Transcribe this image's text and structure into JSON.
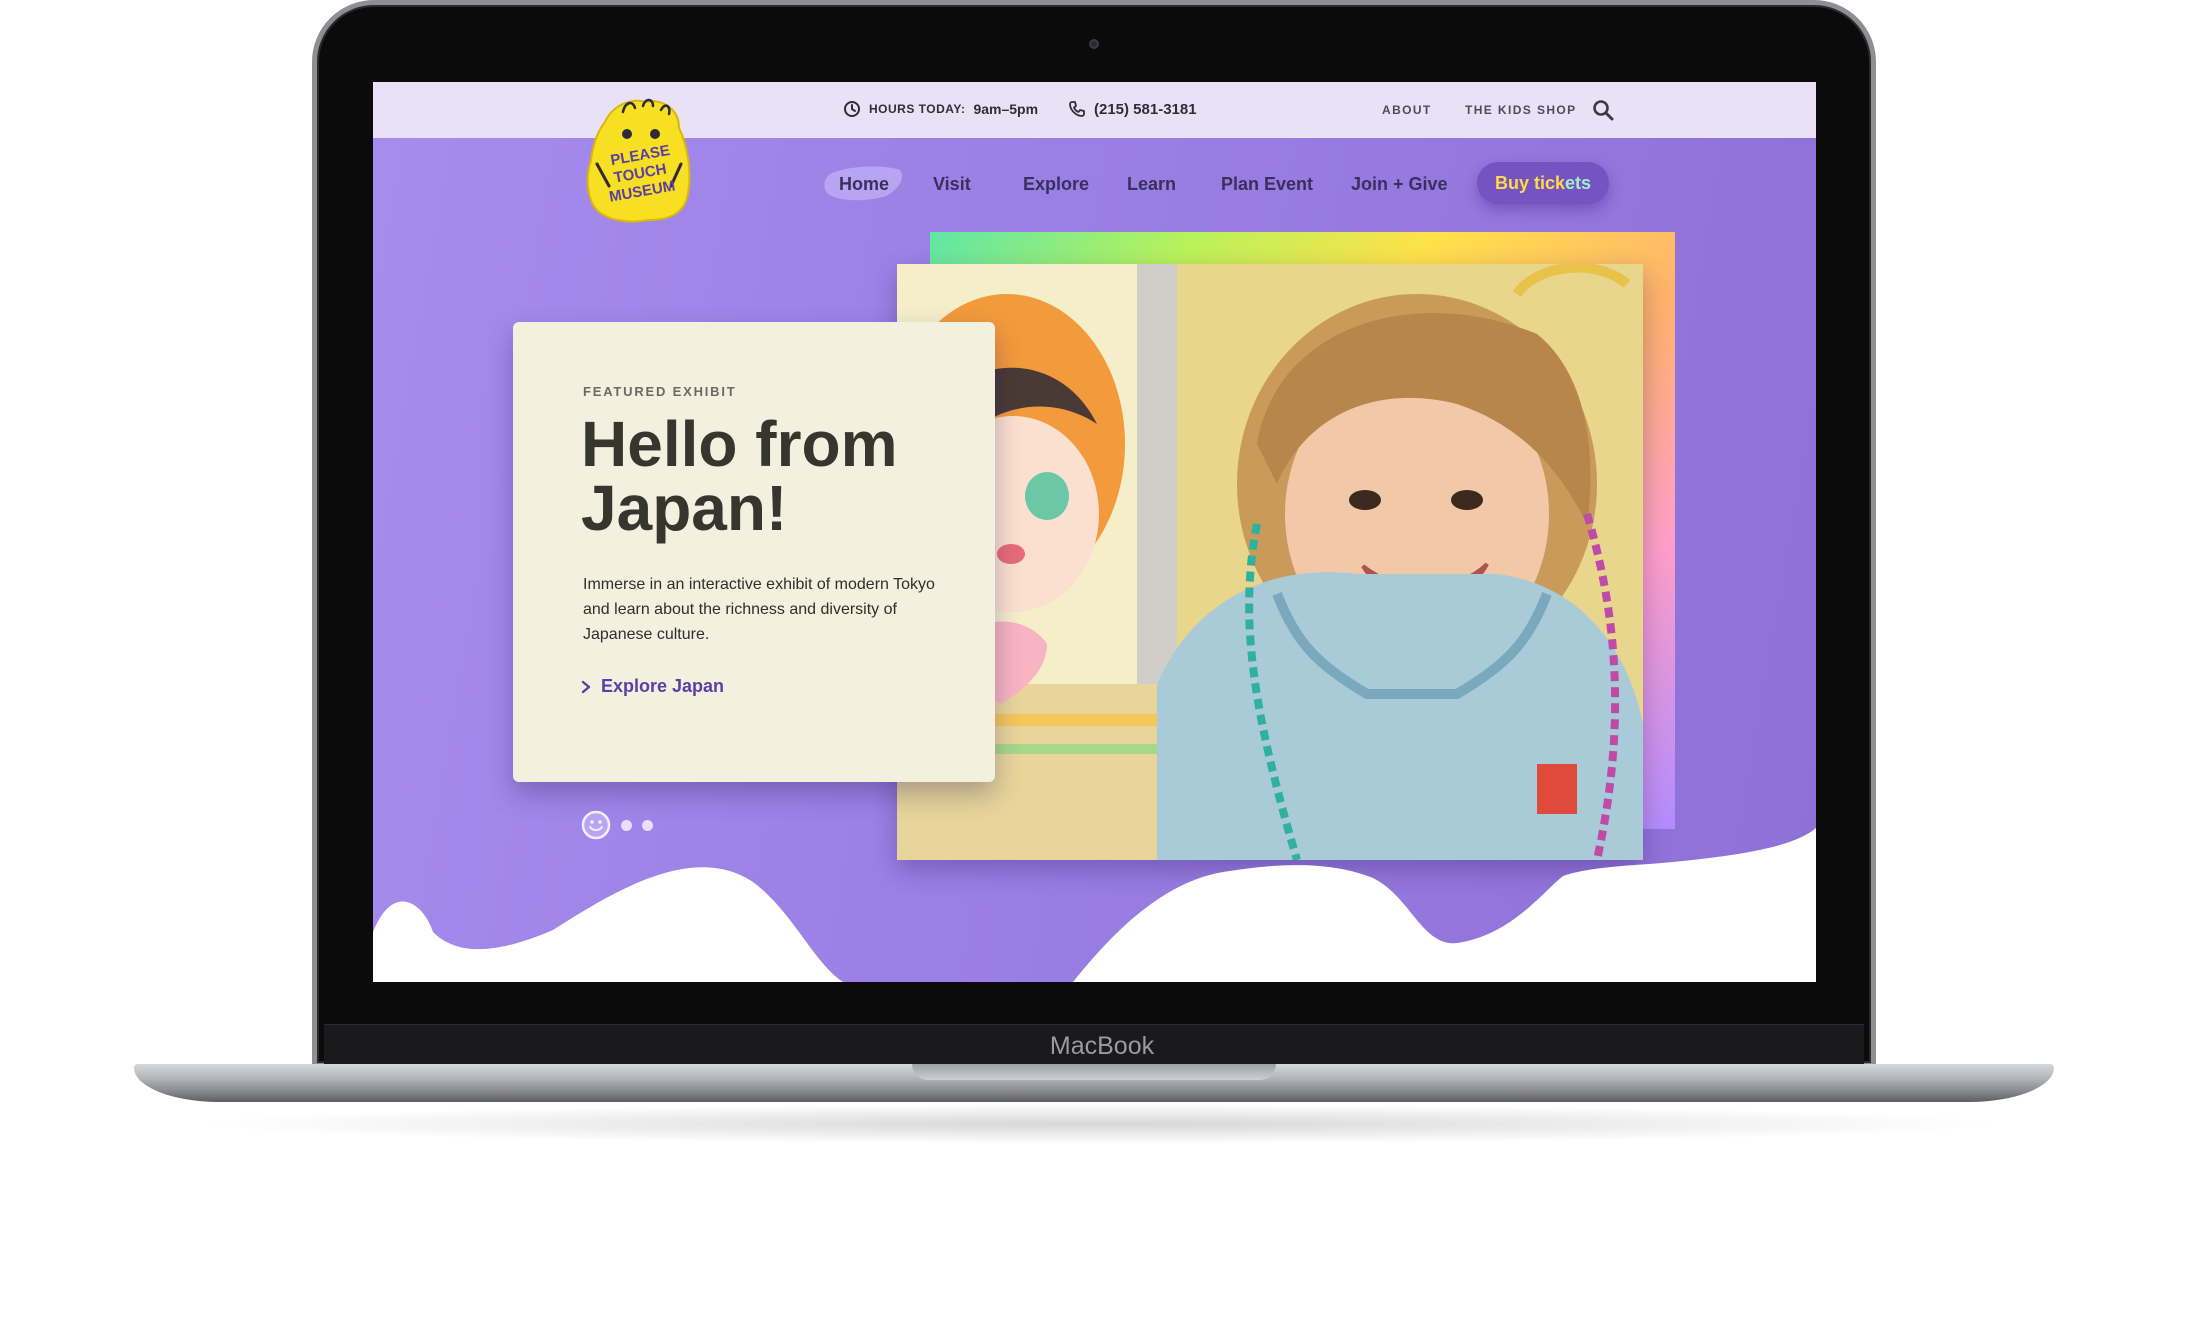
{
  "device": {
    "brand_label": "MacBook"
  },
  "topbar": {
    "hours_label": "HOURS TODAY:",
    "hours_value": "9am–5pm",
    "phone": "(215) 581-3181",
    "links": [
      {
        "label": "ABOUT"
      },
      {
        "label": "THE KIDS SHOP"
      }
    ]
  },
  "logo": {
    "lines": [
      "PLEASE",
      "TOUCH",
      "MUSEUM"
    ]
  },
  "nav": {
    "items": [
      {
        "label": "Home",
        "active": true
      },
      {
        "label": "Visit"
      },
      {
        "label": "Explore"
      },
      {
        "label": "Learn"
      },
      {
        "label": "Plan Event"
      },
      {
        "label": "Join + Give"
      }
    ],
    "buy_part1": "Buy tick",
    "buy_part2": "ets"
  },
  "hero": {
    "eyebrow": "FEATURED EXHIBIT",
    "title": "Hello from Japan!",
    "description": "Immerse in an interactive exhibit of modern Tokyo and learn about the richness and diversity of Japanese culture.",
    "cta": "Explore Japan",
    "slides": {
      "count": 3,
      "active": 1
    }
  },
  "colors": {
    "hero_purple": "#9a7fe4",
    "topbar": "#e9e2f7",
    "card": "#f3f0df",
    "logo_yellow": "#f7df22",
    "button": "#7554c2"
  }
}
